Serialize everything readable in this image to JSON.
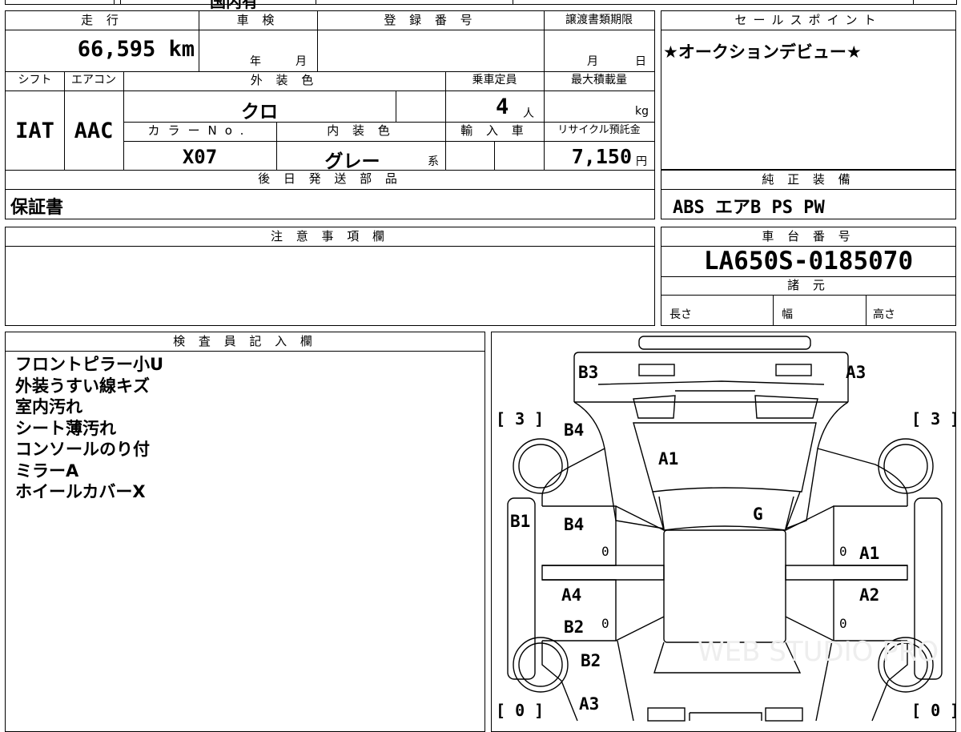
{
  "top_cut": {
    "text": "国内有"
  },
  "labels": {
    "mileage": "走 行",
    "shaken": "車 検",
    "registration": "登 録 番 号",
    "transfer": "譲渡書類期限",
    "sales_point": "セールスポイント",
    "shift": "シフト",
    "aircon": "エアコン",
    "exterior_color": "外 装 色",
    "capacity": "乗車定員",
    "max_load": "最大積載量",
    "color_no": "カラーNo.",
    "interior_color": "内 装 色",
    "import": "輸 入 車",
    "recycle": "リサイクル預託金",
    "later_parts": "後 日 発 送 部 品",
    "standard_equip": "純 正 装 備",
    "notes": "注 意 事 項 欄",
    "chassis_no": "車 台 番 号",
    "specs": "諸 元",
    "length": "長さ",
    "width": "幅",
    "height": "高さ",
    "inspector": "検 査 員 記 入 欄"
  },
  "values": {
    "mileage": "66,595 km",
    "shaken_year": "年",
    "shaken_month": "月",
    "transfer_month": "月",
    "transfer_day": "日",
    "sales_point": "★オークションデビュー★",
    "shift": "IAT",
    "aircon": "AAC",
    "exterior_color": "クロ",
    "capacity": "4",
    "capacity_unit": "人",
    "max_load_unit": "kg",
    "color_no": "X07",
    "interior_color": "グレー",
    "interior_suffix": "系",
    "recycle": "7,150",
    "recycle_unit": "円",
    "later_parts": "保証書",
    "standard_equip": "ABS エアB PS PW",
    "chassis_no": "LA650S-0185070"
  },
  "inspector_remarks": [
    "フロントピラー小U",
    "外装うすい線キズ",
    "室内汚れ",
    "シート薄汚れ",
    "コンソールのり付",
    "ミラーA",
    "ホイールカバーX"
  ],
  "diagram": {
    "labels": {
      "b3": "B3",
      "a3_top": "A3",
      "b4_upper": "B4",
      "a1_windshield": "A1",
      "b1": "B1",
      "b4_door": "B4",
      "g": "G",
      "a1_door": "A1",
      "a4": "A4",
      "a2": "A2",
      "b2_left": "B2",
      "b2_rear": "B2",
      "a3_bottom": "A3"
    },
    "counts": {
      "top_left": "[ 3 ]",
      "top_right": "[ 3 ]",
      "bottom_left": "[ 0 ]",
      "bottom_right": "[ 0 ]"
    },
    "zeros": {
      "z1": "0",
      "z2": "0",
      "z3": "0",
      "z4": "0"
    },
    "watermark": "WEB STUDIO PRO"
  }
}
